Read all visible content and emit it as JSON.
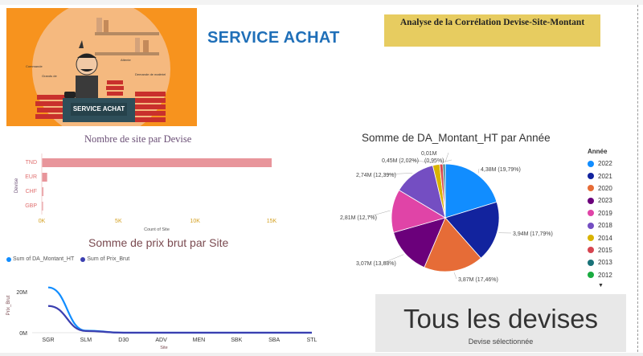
{
  "banner": {
    "label": "SERVICE ACHAT"
  },
  "header": {
    "title": "SERVICE ACHAT",
    "analysis_label": "Analyse de la Corrélation Devise-Site-Montant"
  },
  "bar_chart": {
    "title": "Nombre de site par Devise",
    "xlabel": "Count of Site",
    "ylabel": "Devise",
    "ticks": [
      "0K",
      "5K",
      "10K",
      "15K"
    ]
  },
  "line_chart": {
    "title": "Somme de prix brut par Site",
    "legend": [
      "Sum of DA_Montant_HT",
      "Sum of Prix_Brut"
    ],
    "xlabel": "Site",
    "ylabel": "Prix_Brut",
    "yticks": [
      "20M",
      "0M"
    ]
  },
  "pie_chart": {
    "title": "Somme de DA_Montant_HT par Année",
    "legend_title": "Année"
  },
  "slicer": {
    "value": "Tous les devises",
    "label": "Devise sélectionnée"
  },
  "chart_data": [
    {
      "type": "bar",
      "orientation": "horizontal",
      "title": "Nombre de site par Devise",
      "xlabel": "Count of Site",
      "ylabel": "Devise",
      "categories": [
        "TND",
        "EUR",
        "CHF",
        "GBP"
      ],
      "values": [
        15000,
        350,
        100,
        20
      ],
      "xlim": [
        0,
        15000
      ],
      "color": "#e8959b"
    },
    {
      "type": "line",
      "title": "Somme de prix brut par Site",
      "xlabel": "Site",
      "ylabel": "Prix_Brut",
      "x": [
        "SGR",
        "SLM",
        "D30",
        "ADV",
        "MEN",
        "SBK",
        "SBA",
        "STL"
      ],
      "ylim": [
        0,
        25000000
      ],
      "series": [
        {
          "name": "Sum of DA_Montant_HT",
          "color": "#118dff",
          "values": [
            22000000,
            1000000,
            0,
            0,
            0,
            0,
            0,
            0
          ]
        },
        {
          "name": "Sum of Prix_Brut",
          "color": "#3b3fb0",
          "values": [
            13000000,
            800000,
            0,
            0,
            0,
            0,
            0,
            0
          ]
        }
      ]
    },
    {
      "type": "pie",
      "title": "Somme de DA_Montant_HT par Année",
      "legend_title": "Année",
      "slices": [
        {
          "name": "2022",
          "value": 4.38,
          "label": "4,38M (19,79%)",
          "color": "#118dff"
        },
        {
          "name": "2021",
          "value": 3.94,
          "label": "3,94M (17,79%)",
          "color": "#12239e"
        },
        {
          "name": "2020",
          "value": 3.87,
          "label": "3,87M (17,46%)",
          "color": "#e66c37"
        },
        {
          "name": "2023",
          "value": 3.07,
          "label": "3,07M (13,88%)",
          "color": "#6b007b"
        },
        {
          "name": "2019",
          "value": 2.81,
          "label": "2,81M (12,7%)",
          "color": "#e044a7"
        },
        {
          "name": "2018",
          "value": 2.74,
          "label": "2,74M (12,39%)",
          "color": "#744ec2"
        },
        {
          "name": "2014",
          "value": 0.45,
          "label": "0,45M (2,02%)",
          "color": "#d9b300"
        },
        {
          "name": "2015",
          "value": 0.21,
          "label": "(0,95%)",
          "color": "#d64550"
        },
        {
          "name": "2013",
          "value": 0.14,
          "label": "",
          "color": "#197278"
        },
        {
          "name": "2012",
          "value": 0.01,
          "label": "0,01M",
          "color": "#1aab40"
        }
      ]
    }
  ]
}
